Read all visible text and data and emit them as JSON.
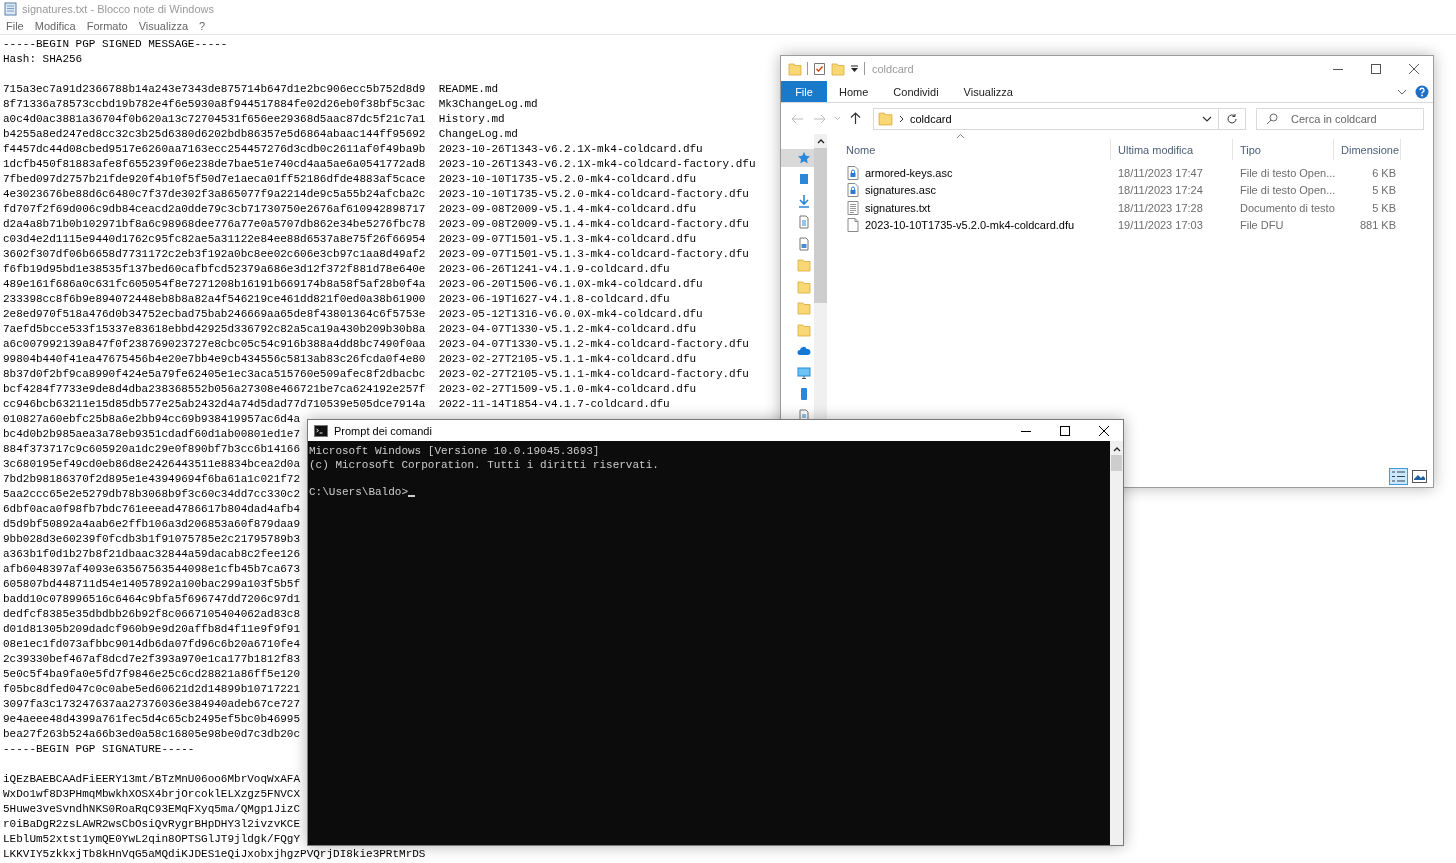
{
  "notepad": {
    "title": "signatures.txt - Blocco note di Windows",
    "menu": [
      "File",
      "Modifica",
      "Formato",
      "Visualizza",
      "?"
    ],
    "blocks": [
      [
        "-----BEGIN PGP SIGNED MESSAGE-----",
        "Hash: SHA256"
      ],
      [
        "715a3ec7a91d2366788b14a243e7343de875714b647d1e2bc906ecc5b752d8d9  README.md",
        "8f71336a78573ccbd19b782e4f6e5930a8f944517884fe02d26eb0f38bf5c3ac  Mk3ChangeLog.md",
        "a0c4d0ac3881a36704f0b620a13c72704531f656ee29368d5aac87dc5f21c7a1  History.md",
        "b4255a8ed247ed8cc32c3b25d6380d6202bdb86357e5d6864abaac144ff95692  ChangeLog.md",
        "f4457dc44d08cbed9517e6260aa7163ecc254457276d3cdb0c2611af0f49ba9b  2023-10-26T1343-v6.2.1X-mk4-coldcard.dfu",
        "1dcfb450f81883afe8f655239f06e238de7bae51e740cd4aa5ae6a0541772ad8  2023-10-26T1343-v6.2.1X-mk4-coldcard-factory.dfu",
        "7fbed097d2757b21fde920f4b10f5f50d7e1aeca01ff52186dfde4883af5cace  2023-10-10T1735-v5.2.0-mk4-coldcard.dfu",
        "4e3023676be88d6c6480c7f37de302f3a865077f9a2214de9c5a55b24afcba2c  2023-10-10T1735-v5.2.0-mk4-coldcard-factory.dfu",
        "fd707f2f69d006c9db84ceacd2a0dde79c3cb71730750e2676af610942898717  2023-09-08T2009-v5.1.4-mk4-coldcard.dfu",
        "d2a4a8b71b0b102971bf8a6c98968dee776a77e0a5707db862e34be5276fbc78  2023-09-08T2009-v5.1.4-mk4-coldcard-factory.dfu",
        "c03d4e2d1115e9440d1762c95fc82ae5a31122e84ee88d6537a8e75f26f66954  2023-09-07T1501-v5.1.3-mk4-coldcard.dfu",
        "3602f307df06b6658d7731172c2eb3f192a0bc8ee02c606e3cb97c1aa8d49af2  2023-09-07T1501-v5.1.3-mk4-coldcard-factory.dfu",
        "f6fb19d95bd1e38535f137bed60cafbfcd52379a686e3d12f372f881d78e640e  2023-06-26T1241-v4.1.9-coldcard.dfu",
        "489e161f686a0c631fc605054f8e7271208b16191b669174b8a58f5af28b0f4a  2023-06-20T1506-v6.1.0X-mk4-coldcard.dfu",
        "233398cc8f6b9e894072448eb8b8a82a4f546219ce461dd821f0ed0a38b61900  2023-06-19T1627-v4.1.8-coldcard.dfu",
        "2e8ed970f518a476d0b34752ecbad75bab246669aa65de8f43801364c6f5753e  2023-05-12T1316-v6.0.0X-mk4-coldcard.dfu",
        "7aefd5bcce533f15337e83618ebbd42925d336792c82a5ca19a430b209b30b8a  2023-04-07T1330-v5.1.2-mk4-coldcard.dfu",
        "a6c007992139a847f0f238769023727e8cbc05c54c916b388a4dd8bc7490f0aa  2023-04-07T1330-v5.1.2-mk4-coldcard-factory.dfu",
        "99804b440f41ea47675456b4e20e7bb4e9cb434556c5813ab83c26fcda0f4e80  2023-02-27T2105-v5.1.1-mk4-coldcard.dfu",
        "8b37d0f2bf9ca8990f424e5a79fe62405e1ec3aca515760e509afec8f2dbacbc  2023-02-27T2105-v5.1.1-mk4-coldcard-factory.dfu",
        "bcf4284f7733e9de8d4dba238368552b056a27308e466721be7ca624192e257f  2023-02-27T1509-v5.1.0-mk4-coldcard.dfu",
        "cc946bcb63211e15d85db577e25ab2432d4a74d5dad77d710539e505dce7914a  2022-11-14T1854-v4.1.7-coldcard.dfu",
        "010827a60ebfc25b8a6e2bb94cc69b938419957ac6d4a",
        "bc4d0b2b985aea3a78eb9351cdadf60d1ab00801ed1e7",
        "884f373717c9c605920a1dc29e0f890bf7b3cc6b14166",
        "3c680195ef49cd0eb86d8e2426443511e8834bcea2d0a",
        "7bd2b98186370f2d895e1e43949694f6ba61a1c021f72",
        "5aa2ccc65e2e5279db78b3068b9f3c60c34dd7cc330c2",
        "6dbf0aca0f98fb7bdc761eeead4786617b804dad4afb4",
        "d5d9bf50892a4aab6e2ffb106a3d206853a60f879daa9",
        "9bb028d3e60239f0fcdb3b1f91075785e2c21795789b3",
        "a363b1f0d1b27b8f21dbaac32844a59dacab8c2fee126",
        "afb6048397af4093e63567563544098e1cfb45b7ca673",
        "605807bd448711d54e14057892a100bac299a103f5b5f",
        "badd10c078996516c6464c9bfa5f696747dd7206c97d1",
        "dedfcf8385e35dbdbb26b92f8c0667105404062ad83c8",
        "d01d81305b209dadcf960b9e9d20affb8d4f11e9f9f91",
        "08e1ec1fd073afbbc9014db6da07fd96c6b20a6710fe4",
        "2c39330bef467af8dcd7e2f393a970e1ca177b1812f83",
        "5e0c5f4ba9fa0e5fd7f9846e25c6cd28821a86ff5e120",
        "f05bc8dfed047c0c0abe5ed60621d2d14899b10717221",
        "3097fa3c173247637aa27376036e384940adeb67ce727",
        "9e4aeee48d4399a761fec5d4c65cb2495ef5bc0b46995",
        "bea27f263b524a66b3ed0a58c16805e98be0d7c3db20c",
        "-----BEGIN PGP SIGNATURE-----"
      ],
      [
        "iQEzBAEBCAAdFiEERY13mt/BTzMnU06oo6MbrVoqWxAFA",
        "WxDo1wf8D3PHmqMbwkhXOSX4brjOrcoklELXzgz5FNVCX",
        "5Huwe3veSvndhNKS0RoaRqC93EMqFXyq5ma/QMgp1JizC",
        "r0iBaDgR2zsLAWR2wsCbOsiQvRygrBHpDHY3l2ivzvKCE",
        "LEblUm52xtst1ymQE0YwL2qin8OPTSGlJT9jldgk/FQgY",
        "LKKVIY5zkkxjTb8kHnVqG5aMQdiKJDES1eQiJxobxjhgzPVQrjDI8kie3PRtMrDS"
      ]
    ]
  },
  "explorer": {
    "title": "coldcard",
    "file_tab": "File",
    "ribbon_tabs": [
      "Home",
      "Condividi",
      "Visualizza"
    ],
    "address": "coldcard",
    "search": {
      "placeholder": "Cerca in coldcard"
    },
    "columns": [
      "Nome",
      "Ultima modifica",
      "Tipo",
      "Dimensione"
    ],
    "rows": [
      {
        "kind": "signed",
        "name": "armored-keys.asc",
        "modified": "18/11/2023 17:47",
        "type": "File di testo Open...",
        "size": "6 KB"
      },
      {
        "kind": "signed",
        "name": "signatures.asc",
        "modified": "18/11/2023 17:24",
        "type": "File di testo Open...",
        "size": "5 KB"
      },
      {
        "kind": "text",
        "name": "signatures.txt",
        "modified": "18/11/2023 17:28",
        "type": "Documento di testo",
        "size": "5 KB"
      },
      {
        "kind": "blank",
        "name": "2023-10-10T1735-v5.2.0-mk4-coldcard.dfu",
        "modified": "19/11/2023 17:03",
        "type": "File DFU",
        "size": "881 KB"
      }
    ]
  },
  "console": {
    "title": "Prompt dei comandi",
    "output": [
      "Microsoft Windows [Versione 10.0.19045.3693]",
      "(c) Microsoft Corporation. Tutti i diritti riservati."
    ],
    "prompt": "C:\\Users\\Baldo>"
  }
}
